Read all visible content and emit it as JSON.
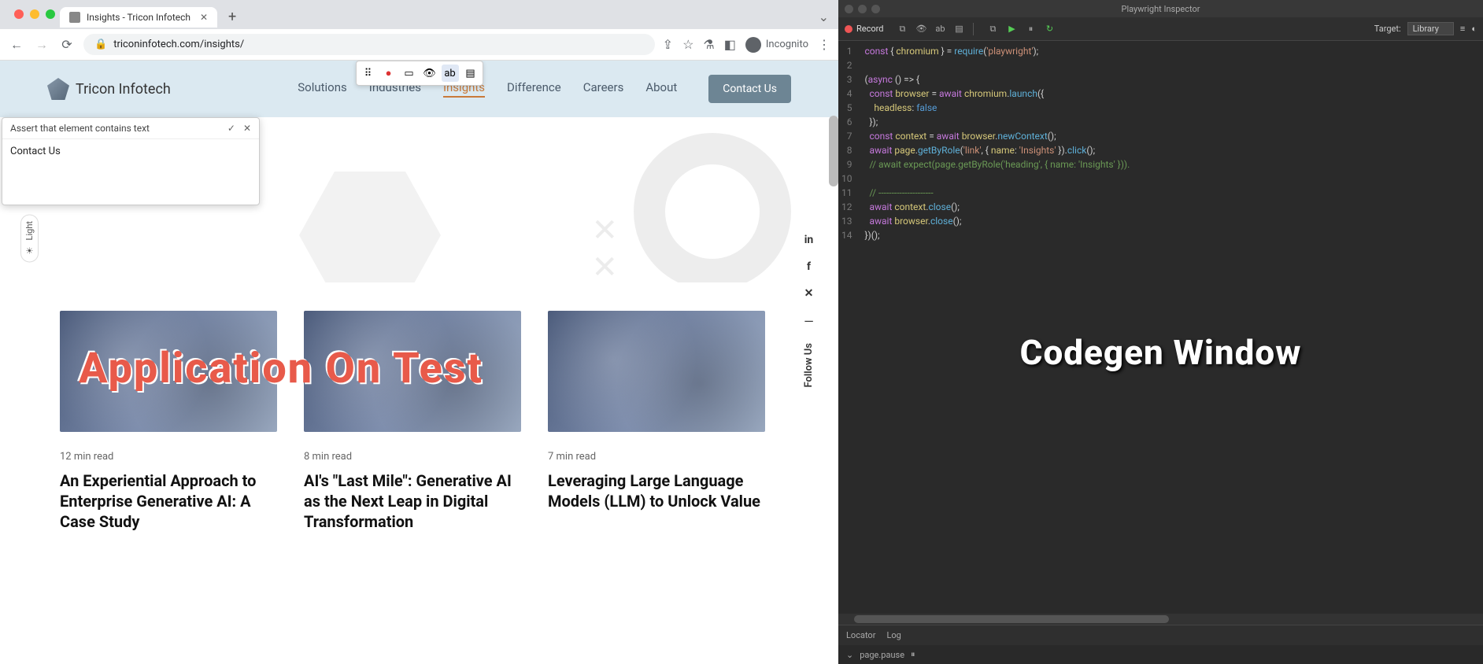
{
  "browser": {
    "tab_title": "Insights - Tricon Infotech",
    "url_host": "triconinfotech.com",
    "url_path": "/insights/",
    "incognito_label": "Incognito"
  },
  "site": {
    "brand": "Tricon Infotech",
    "nav": [
      "Solutions",
      "Industries",
      "Insights",
      "Difference",
      "Careers",
      "About"
    ],
    "nav_active_index": 2,
    "contact_btn": "Contact Us",
    "light_label": "Light",
    "follow_label": "Follow Us"
  },
  "overlay_text": "Application On Test",
  "assert_popup": {
    "header": "Assert that element contains text",
    "value": "Contact Us"
  },
  "cards": [
    {
      "meta": "12 min read",
      "title": "An Experiential Approach to Enterprise Generative AI: A Case Study"
    },
    {
      "meta": "8 min read",
      "title": "AI's \"Last Mile\": Generative AI as the Next Leap in Digital Transformation"
    },
    {
      "meta": "7 min read",
      "title": "Leveraging Large Language Models (LLM) to Unlock Value"
    }
  ],
  "inspector": {
    "title": "Playwright Inspector",
    "record_label": "Record",
    "target_label": "Target:",
    "target_value": "Library",
    "tabs": [
      "Locator",
      "Log"
    ],
    "status": "page.pause",
    "codegen_overlay": "Codegen Window",
    "code_lines": [
      {
        "n": 1,
        "html": "<span class='kw'>const</span> { <span class='id'>chromium</span> } = <span class='fn'>require</span>(<span class='str'>'playwright'</span>);"
      },
      {
        "n": 2,
        "html": ""
      },
      {
        "n": 3,
        "html": "(<span class='kw'>async</span> () <span class='pn'>=&gt;</span> {"
      },
      {
        "n": 4,
        "html": "  <span class='kw'>const</span> <span class='id'>browser</span> = <span class='kw'>await</span> <span class='id'>chromium</span>.<span class='fn'>launch</span>({"
      },
      {
        "n": 5,
        "html": "    <span class='id'>headless</span>: <span class='bool'>false</span>"
      },
      {
        "n": 6,
        "html": "  });"
      },
      {
        "n": 7,
        "html": "  <span class='kw'>const</span> <span class='id'>context</span> = <span class='kw'>await</span> <span class='id'>browser</span>.<span class='fn'>newContext</span>();"
      },
      {
        "n": 8,
        "html": "  <span class='kw'>await</span> <span class='id'>page</span>.<span class='fn'>getByRole</span>(<span class='str'>'link'</span>, { <span class='id'>name</span>: <span class='str'>'Insights'</span> }).<span class='fn'>click</span>();"
      },
      {
        "n": 9,
        "html": "  <span class='cm'>// await expect(page.getByRole('heading', { name: 'Insights' })).</span>"
      },
      {
        "n": 10,
        "html": ""
      },
      {
        "n": 11,
        "html": "  <span class='cm'>// ---------------------</span>"
      },
      {
        "n": 12,
        "html": "  <span class='kw'>await</span> <span class='id'>context</span>.<span class='fn'>close</span>();"
      },
      {
        "n": 13,
        "html": "  <span class='kw'>await</span> <span class='id'>browser</span>.<span class='fn'>close</span>();"
      },
      {
        "n": 14,
        "html": "})();"
      }
    ]
  }
}
